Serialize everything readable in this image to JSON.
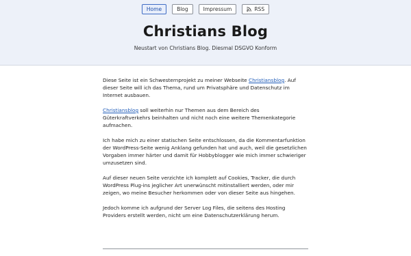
{
  "nav": {
    "items": [
      {
        "label": "Home"
      },
      {
        "label": "Blog"
      },
      {
        "label": "Impressum"
      },
      {
        "label": "RSS"
      }
    ]
  },
  "header": {
    "title": "Christians Blog",
    "subtitle": "Neustart von Christians Blog. Diesmal DSGVO Konform"
  },
  "content": {
    "p1_before": "Diese Seite ist ein Schwesternprojekt zu meiner Webseite ",
    "p1_link": "Christiansblog",
    "p1_after": ". Auf dieser Seite will ich das Thema, rund um Privatsphäre und Datenschutz im Internet ausbauen.",
    "p2_link": "Christiansblog",
    "p2_after": " soll weiterhin nur Themen aus dem Bereich des Güterkraftverkehrs beinhalten und nicht noch eine weitere Themenkategorie aufmachen.",
    "p3": "Ich habe mich zu einer statischen Seite entschlossen, da die Kommentarfunktion der WordPress-Seite wenig Anklang gefunden hat und auch, weil die gesetzlichen Vorgaben immer härter und damit für Hobbyblogger wie mich immer schwieriger umzusetzen sind.",
    "p4": "Auf dieser neuen Seite verzichte ich komplett auf Cookies, Tracker, die durch WordPress Plug-ins jeglicher Art unerwünscht mitinstalliert werden, oder mir zeigen, wo meine Besucher herkommen oder von dieser Seite aus hingehen.",
    "p5": "Jedoch komme ich aufgrund der Server Log Files, die seitens des Hosting Providers erstellt werden, nicht um eine Datenschutzerklärung herum."
  }
}
